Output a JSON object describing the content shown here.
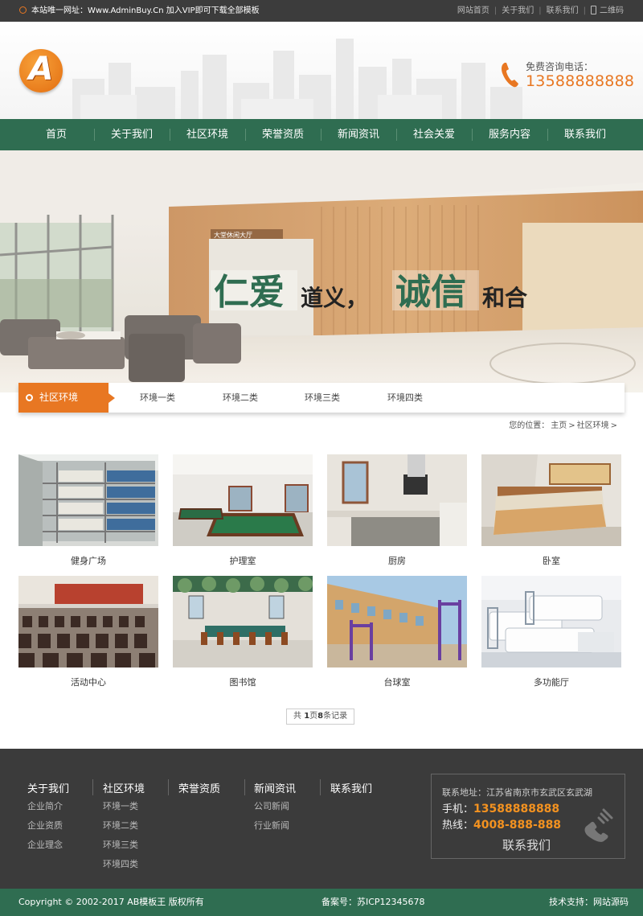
{
  "topbar": {
    "notice": "本站唯一网址：Www.AdminBuy.Cn 加入VIP即可下载全部模板",
    "links": [
      "网站首页",
      "关于我们",
      "联系我们"
    ],
    "qrcode": "二维码"
  },
  "header": {
    "logo_letter": "A",
    "hotline_label": "免费咨询电话：",
    "hotline_number": "13588888888"
  },
  "nav": {
    "items": [
      "首页",
      "关于我们",
      "社区环境",
      "荣誉资质",
      "新闻资讯",
      "社会关爱",
      "服务内容",
      "联系我们"
    ]
  },
  "banner": {
    "slogan_a": "仁爱",
    "slogan_b": "道义，",
    "slogan_c": "诚信",
    "slogan_d": "和合",
    "sign_text": "大堂休闲大厅"
  },
  "subnav": {
    "current": "社区环境",
    "items": [
      "环境一类",
      "环境二类",
      "环境三类",
      "环境四类"
    ]
  },
  "breadcrumb": {
    "label": "您的位置：",
    "home": "主页",
    "current": "社区环境"
  },
  "gallery": {
    "items": [
      {
        "caption": "健身广场",
        "icon": "bookshelf-photo"
      },
      {
        "caption": "护理室",
        "icon": "billiard-room-photo"
      },
      {
        "caption": "厨房",
        "icon": "kitchen-photo"
      },
      {
        "caption": "卧室",
        "icon": "bedroom-photo"
      },
      {
        "caption": "活动中心",
        "icon": "meeting-hall-photo"
      },
      {
        "caption": "图书馆",
        "icon": "dining-room-photo"
      },
      {
        "caption": "台球室",
        "icon": "outdoor-fitness-photo"
      },
      {
        "caption": "多功能厅",
        "icon": "ward-photo"
      }
    ]
  },
  "pager": {
    "prefix": "共 ",
    "pages": "1",
    "mid": "页",
    "records": "8",
    "suffix": "条记录"
  },
  "footer": {
    "columns": [
      {
        "title": "关于我们",
        "links": [
          "企业简介",
          "企业资质",
          "企业理念"
        ]
      },
      {
        "title": "社区环境",
        "links": [
          "环境一类",
          "环境二类",
          "环境三类",
          "环境四类"
        ]
      },
      {
        "title": "荣誉资质",
        "links": []
      },
      {
        "title": "新闻资讯",
        "links": [
          "公司新闻",
          "行业新闻"
        ]
      },
      {
        "title": "联系我们",
        "links": []
      }
    ],
    "contact": {
      "address": "联系地址：江苏省南京市玄武区玄武湖",
      "mobile_label": "手机：",
      "mobile": "13588888888",
      "tel_label": "热线：",
      "tel": "4008-888-888",
      "contact_us": "联系我们"
    }
  },
  "copyright": {
    "left": "Copyright © 2002-2017 AB模板王 版权所有",
    "center": "备案号：苏ICP12345678",
    "right": "技术支持：网站源码"
  },
  "colors": {
    "brand_green": "#2f6d51",
    "accent_orange": "#e87722",
    "dark_gray": "#3b3b3b"
  }
}
